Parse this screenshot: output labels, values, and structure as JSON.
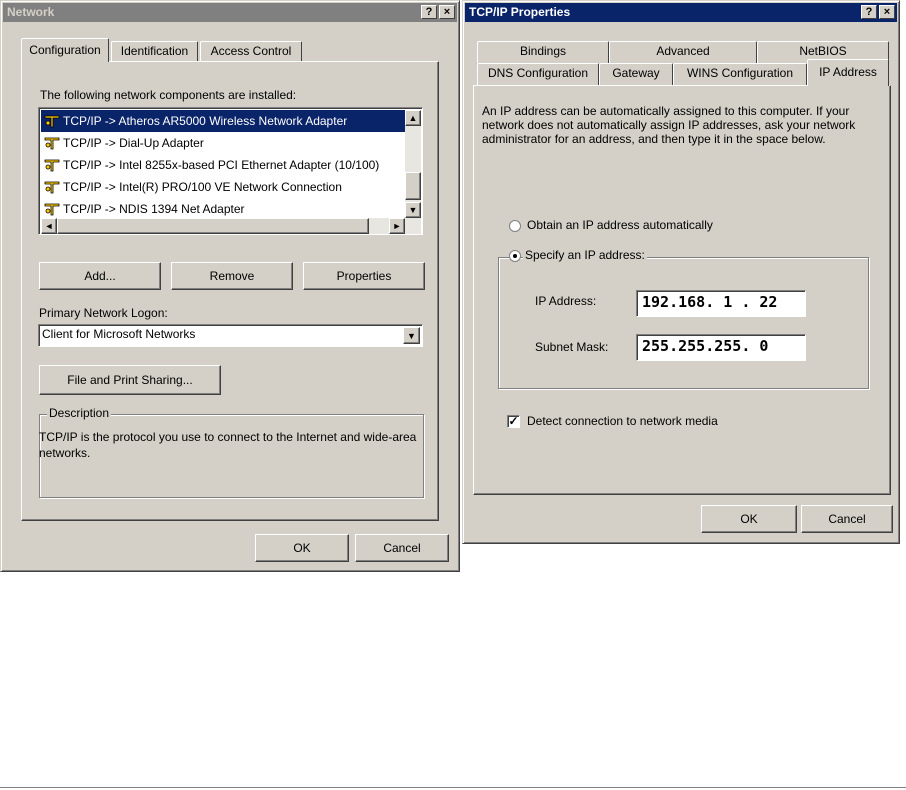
{
  "network": {
    "title": "Network",
    "help_glyph": "?",
    "close_glyph": "×",
    "tabs": [
      "Configuration",
      "Identification",
      "Access Control"
    ],
    "installed_label": "The following network components are installed:",
    "components": [
      "TCP/IP -> Atheros AR5000 Wireless Network Adapter",
      "TCP/IP -> Dial-Up Adapter",
      "TCP/IP -> Intel 8255x-based PCI Ethernet Adapter (10/100)",
      "TCP/IP -> Intel(R) PRO/100 VE Network Connection",
      "TCP/IP -> NDIS 1394 Net Adapter"
    ],
    "add_label": "Add...",
    "remove_label": "Remove",
    "properties_label": "Properties",
    "logon_label": "Primary Network Logon:",
    "logon_value": "Client for Microsoft Networks",
    "file_print_label": "File and Print Sharing...",
    "description_title": "Description",
    "description_text": "TCP/IP is the protocol you use to connect to the Internet and wide-area networks.",
    "ok_label": "OK",
    "cancel_label": "Cancel"
  },
  "tcpip": {
    "title": "TCP/IP Properties",
    "help_glyph": "?",
    "close_glyph": "×",
    "tabs_back": [
      "Bindings",
      "Advanced",
      "NetBIOS"
    ],
    "tabs_front": [
      "DNS Configuration",
      "Gateway",
      "WINS Configuration",
      "IP Address"
    ],
    "intro_text": "An IP address can be automatically assigned to this computer. If your network does not automatically assign IP addresses, ask your network administrator for an address, and then type it in the space below.",
    "obtain_label": "Obtain an IP address automatically",
    "specify_label": "Specify an IP address:",
    "ip_label": "IP Address:",
    "ip_value": "192.168. 1 . 22",
    "subnet_label": "Subnet Mask:",
    "subnet_value": "255.255.255. 0",
    "detect_label": "Detect connection to network media",
    "ok_label": "OK",
    "cancel_label": "Cancel"
  },
  "colors": {
    "face": "#d4d0c8",
    "active_title": "#0a246a",
    "inactive_title": "#808080",
    "selection": "#0a246a"
  },
  "icons": {
    "help": "help-icon",
    "close": "close-icon",
    "network_component": "network-adapter-icon",
    "scroll_up": "arrow-up-icon",
    "scroll_down": "arrow-down-icon",
    "scroll_left": "arrow-left-icon",
    "scroll_right": "arrow-right-icon",
    "dropdown": "chevron-down-icon"
  }
}
